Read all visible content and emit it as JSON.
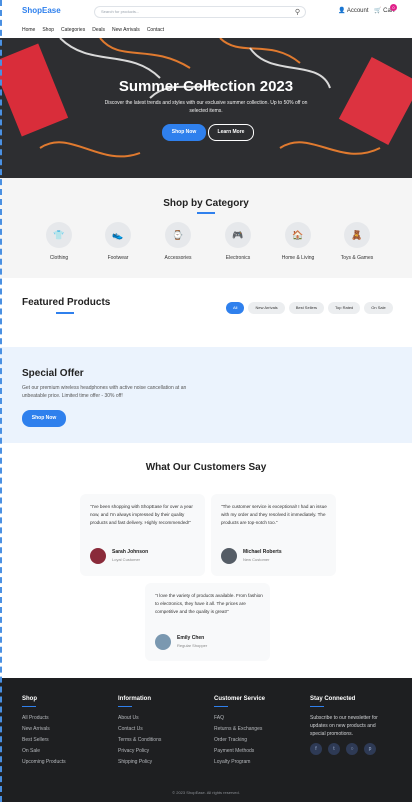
{
  "header": {
    "logo": "ShopEase",
    "search_placeholder": "Search for products...",
    "account_label": "Account",
    "cart_label": "Cart",
    "cart_count": "0",
    "nav": [
      "Home",
      "Shop",
      "Categories",
      "Deals",
      "New Arrivals",
      "Contact"
    ]
  },
  "hero": {
    "title": "Summer Collection 2023",
    "subtitle": "Discover the latest trends and styles with our exclusive summer collection. Up to 50% off on selected items.",
    "primary_button": "Shop Now",
    "secondary_button": "Learn More"
  },
  "categories": {
    "title": "Shop by Category",
    "items": [
      {
        "label": "Clothing",
        "icon": "shirt-icon"
      },
      {
        "label": "Footwear",
        "icon": "shoe-icon"
      },
      {
        "label": "Accessories",
        "icon": "watch-icon"
      },
      {
        "label": "Electronics",
        "icon": "gamepad-icon"
      },
      {
        "label": "Home & Living",
        "icon": "home-icon"
      },
      {
        "label": "Toys & Games",
        "icon": "toy-icon"
      }
    ]
  },
  "featured": {
    "title": "Featured Products",
    "filters": [
      "All",
      "New Arrivals",
      "Best Sellers",
      "Top Rated",
      "On Sale"
    ],
    "active_filter": "All"
  },
  "offer": {
    "title": "Special Offer",
    "text": "Get our premium wireless headphones with active noise cancellation at an unbeatable price. Limited time offer - 30% off!",
    "button": "Shop Now"
  },
  "testimonials": {
    "title": "What Our Customers Say",
    "items": [
      {
        "quote": "\"I've been shopping with ShopEase for over a year now, and I'm always impressed by their quality products and fast delivery. Highly recommended!\"",
        "name": "Sarah Johnson",
        "role": "Loyal Customer"
      },
      {
        "quote": "\"The customer service is exceptional! I had an issue with my order and they resolved it immediately. The products are top-notch too.\"",
        "name": "Michael Roberts",
        "role": "New Customer"
      },
      {
        "quote": "\"I love the variety of products available. From fashion to electronics, they have it all. The prices are competitive and the quality is great!\"",
        "name": "Emily Chen",
        "role": "Regular Shopper"
      }
    ]
  },
  "footer": {
    "columns": [
      {
        "title": "Shop",
        "links": [
          "All Products",
          "New Arrivals",
          "Best Sellers",
          "On Sale",
          "Upcoming Products"
        ]
      },
      {
        "title": "Information",
        "links": [
          "About Us",
          "Contact Us",
          "Terms & Conditions",
          "Privacy Policy",
          "Shipping Policy"
        ]
      },
      {
        "title": "Customer Service",
        "links": [
          "FAQ",
          "Returns & Exchanges",
          "Order Tracking",
          "Payment Methods",
          "Loyalty Program"
        ]
      }
    ],
    "stay_connected": {
      "title": "Stay Connected",
      "text": "Subscribe to our newsletter for updates on new products and special promotions.",
      "social": [
        "facebook-icon",
        "twitter-icon",
        "instagram-icon",
        "pinterest-icon"
      ]
    },
    "copyright": "© 2023 ShopEase. All rights reserved."
  },
  "colors": {
    "accent": "#2f80ed",
    "badge": "#e0208a",
    "hero_bg": "#2d2e31",
    "footer_bg": "#1e1f21",
    "offer_bg": "#ebf3fd"
  }
}
